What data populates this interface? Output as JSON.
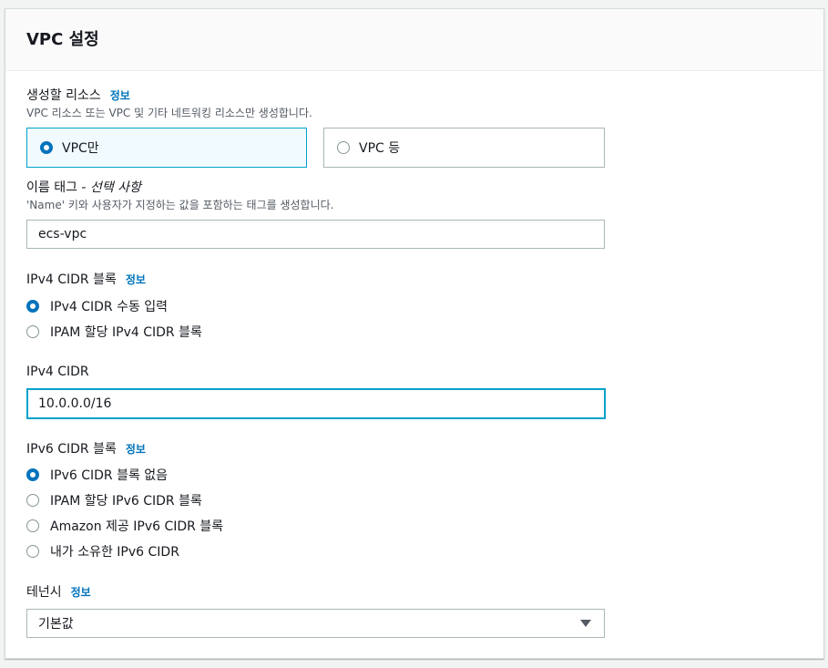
{
  "panel": {
    "title": "VPC 설정"
  },
  "resources": {
    "label": "생성할 리소스",
    "info": "정보",
    "description": "VPC 리소스 또는 VPC 및 기타 네트워킹 리소스만 생성합니다.",
    "options": [
      {
        "label": "VPC만",
        "selected": true
      },
      {
        "label": "VPC 등",
        "selected": false
      }
    ]
  },
  "name_tag": {
    "label": "이름 태그 - ",
    "label_optional": "선택 사항",
    "description": "'Name' 키와 사용자가 지정하는 값을 포함하는 태그를 생성합니다.",
    "value": "ecs-vpc"
  },
  "ipv4_block": {
    "label": "IPv4 CIDR 블록",
    "info": "정보",
    "options": [
      {
        "label": "IPv4 CIDR 수동 입력",
        "selected": true
      },
      {
        "label": "IPAM 할당 IPv4 CIDR 블록",
        "selected": false
      }
    ]
  },
  "ipv4_cidr": {
    "label": "IPv4 CIDR",
    "value": "10.0.0.0/16"
  },
  "ipv6_block": {
    "label": "IPv6 CIDR 블록",
    "info": "정보",
    "options": [
      {
        "label": "IPv6 CIDR 블록 없음",
        "selected": true
      },
      {
        "label": "IPAM 할당 IPv6 CIDR 블록",
        "selected": false
      },
      {
        "label": "Amazon 제공 IPv6 CIDR 블록",
        "selected": false
      },
      {
        "label": "내가 소유한 IPv6 CIDR",
        "selected": false
      }
    ]
  },
  "tenancy": {
    "label": "테넌시",
    "info": "정보",
    "selected": "기본값"
  },
  "colors": {
    "accent": "#0073bb",
    "focus": "#00a1c9",
    "border": "#aab7b8"
  }
}
